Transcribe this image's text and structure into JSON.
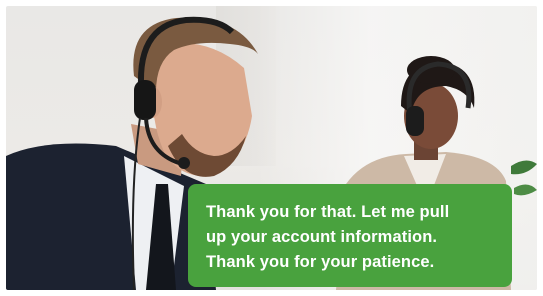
{
  "video": {
    "caption": {
      "lines": [
        "Thank you for that. Let me pull",
        "up your account information.",
        "Thank you for your patience."
      ],
      "background_color": "#49a23e",
      "text_color": "#ffffff"
    }
  }
}
